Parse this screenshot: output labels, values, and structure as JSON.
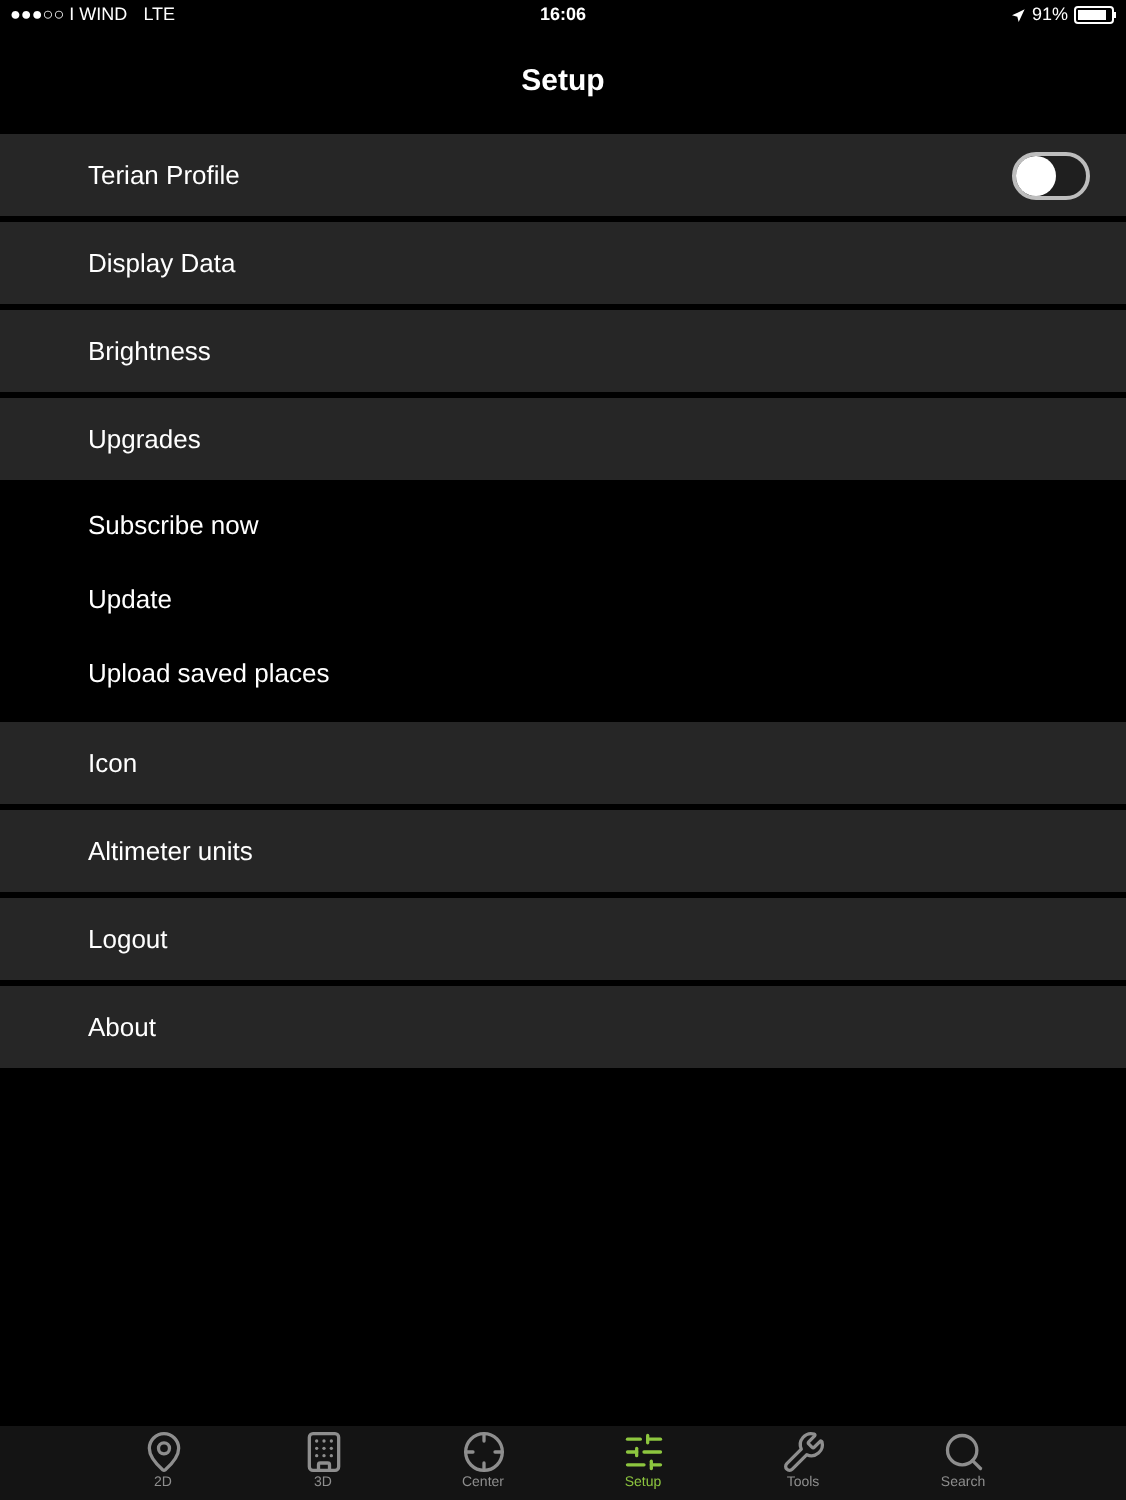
{
  "status_bar": {
    "carrier": "●●●○○ I WIND",
    "network": "LTE",
    "time": "16:06",
    "battery": "91%"
  },
  "title": "Setup",
  "sections": [
    {
      "kind": "grouped",
      "items": [
        {
          "label": "Terian Profile",
          "kind": "toggle",
          "on": false
        },
        {
          "label": "Display Data",
          "kind": "row"
        },
        {
          "label": "Brightness",
          "kind": "row"
        },
        {
          "label": "Upgrades",
          "kind": "row"
        }
      ]
    },
    {
      "kind": "plain",
      "items": [
        {
          "label": "Subscribe now"
        },
        {
          "label": "Update"
        },
        {
          "label": "Upload saved places"
        }
      ]
    },
    {
      "kind": "grouped",
      "items": [
        {
          "label": "Icon",
          "kind": "row"
        },
        {
          "label": "Altimeter units",
          "kind": "row"
        },
        {
          "label": "Logout",
          "kind": "row"
        },
        {
          "label": "About",
          "kind": "row"
        }
      ]
    }
  ],
  "tab_bar": [
    {
      "label": "2D",
      "kind": "pin",
      "selected": false
    },
    {
      "label": "3D",
      "kind": "building",
      "selected": false
    },
    {
      "label": "Center",
      "kind": "crosshair",
      "selected": false
    },
    {
      "label": "Setup",
      "kind": "sliders",
      "selected": true
    },
    {
      "label": "Tools",
      "kind": "tools",
      "selected": false
    },
    {
      "label": "Search",
      "kind": "search",
      "selected": false
    }
  ]
}
